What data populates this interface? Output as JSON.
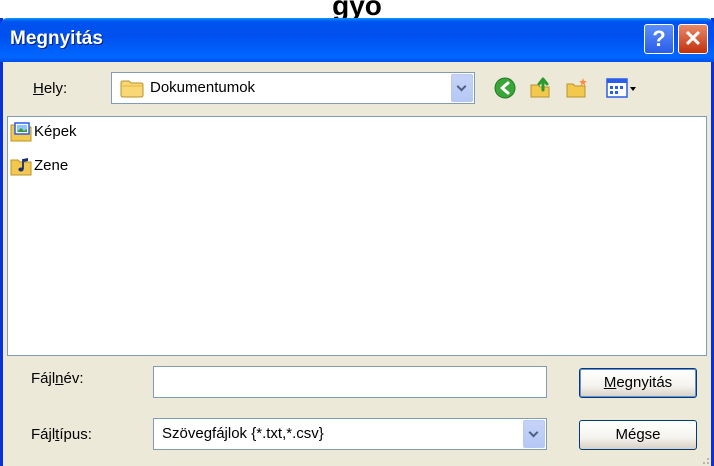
{
  "window": {
    "title": "Megnyitás"
  },
  "background_heading": "gyo",
  "location": {
    "label_prefix": "",
    "label_hotkey": "H",
    "label_suffix": "ely:",
    "current_folder": "Dokumentumok"
  },
  "toolbar": {
    "icons": [
      "back-icon",
      "up-folder-icon",
      "new-folder-icon",
      "view-menu-icon"
    ]
  },
  "files": [
    {
      "name": "Képek",
      "icon": "pictures-folder-icon"
    },
    {
      "name": "Zene",
      "icon": "music-folder-icon"
    }
  ],
  "filename": {
    "label_prefix": "Fájl",
    "label_hotkey": "n",
    "label_suffix": "év:",
    "value": ""
  },
  "filetype": {
    "label_prefix": "Fájl",
    "label_hotkey": "t",
    "label_suffix": "ípus:",
    "selected": "Szövegfájlok {*.txt,*.csv}"
  },
  "buttons": {
    "open_hotkey": "M",
    "open_rest": "egnyitás",
    "cancel": "Mégse"
  },
  "colors": {
    "titlebar": "#0053ee",
    "dialog_bg": "#ece9d8",
    "border": "#0831d9",
    "close_button": "#c2300c"
  }
}
